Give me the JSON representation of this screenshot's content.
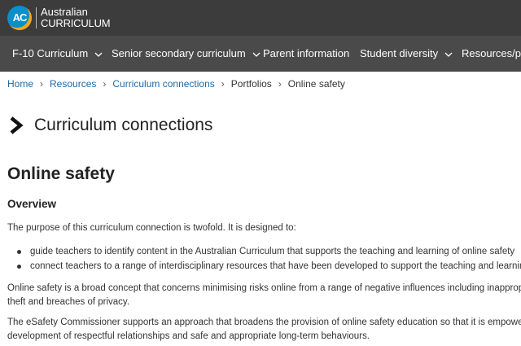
{
  "header": {
    "logo_badge": "AC",
    "logo_line1": "Australian",
    "logo_line2": "CURRICULUM"
  },
  "nav": {
    "items": [
      {
        "label": "F-10 Curriculum",
        "has_dropdown": true
      },
      {
        "label": "Senior secondary curriculum",
        "has_dropdown": true
      },
      {
        "label": "Parent information",
        "has_dropdown": false
      },
      {
        "label": "Student diversity",
        "has_dropdown": true
      },
      {
        "label": "Resources/pul",
        "has_dropdown": false
      }
    ]
  },
  "breadcrumb": {
    "items": [
      "Home",
      "Resources",
      "Curriculum connections",
      "Portfolios",
      "Online safety"
    ],
    "separator": "›"
  },
  "section_title": "Curriculum connections",
  "page_title": "Online safety",
  "overview": {
    "heading": "Overview",
    "intro": "The purpose of this curriculum connection is twofold. It is designed to:",
    "bullets": [
      "guide teachers to identify content in the Australian Curriculum that supports the teaching and learning of online safety",
      "connect teachers to a range of interdisciplinary resources that have been developed to support the teaching and learnin"
    ],
    "para1_line1": "Online safety is a broad concept that concerns minimising risks online from a range of negative influences including inapprop",
    "para1_line2": "theft and breaches of privacy.",
    "para2_line1": "The eSafety Commissioner supports an approach that broadens the provision of online safety education so that it is empowe",
    "para2_line2": "development of respectful relationships and safe and appropriate long-term behaviours."
  },
  "colors": {
    "header_bg": "#3c3c3c",
    "nav_bg": "#4a4a4a",
    "link": "#1e6aa6",
    "logo_blue": "#0a8fc9",
    "logo_orange": "#f3a61c"
  },
  "icons": {
    "dropdown": "chevron-down-icon",
    "section_marker": "chevron-right-icon"
  }
}
